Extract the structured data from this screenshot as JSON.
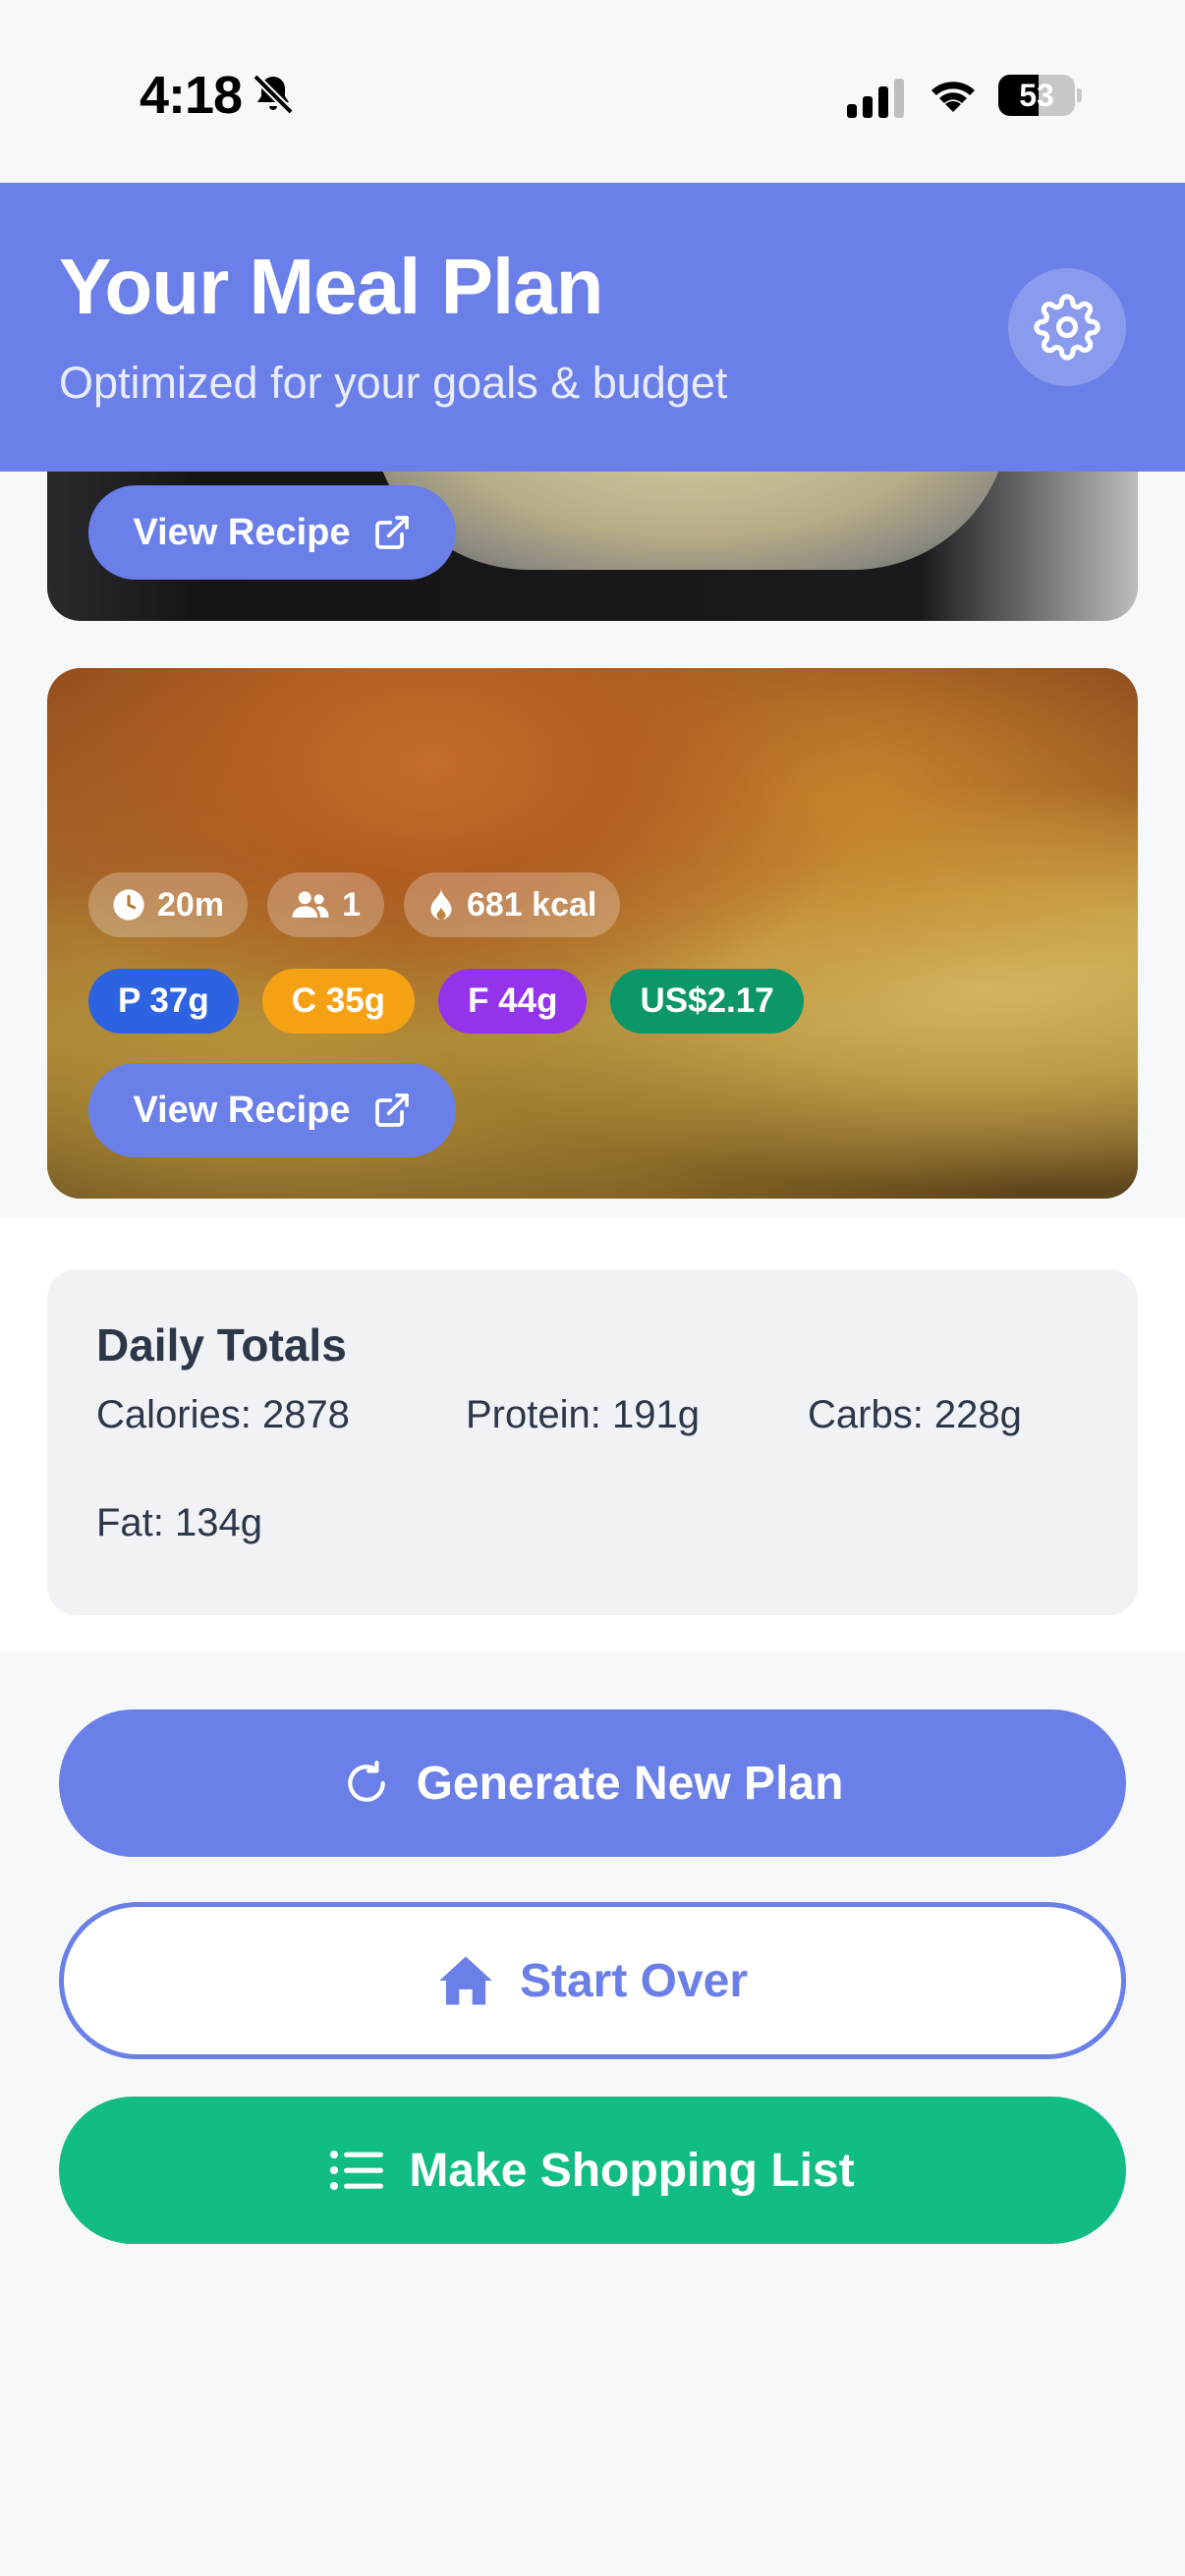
{
  "status_bar": {
    "time": "4:18",
    "battery_level": "53",
    "battery_percent": 53
  },
  "header": {
    "title": "Your Meal Plan",
    "subtitle": "Optimized for your goals & budget",
    "settings_icon": "gear-icon"
  },
  "meals": [
    {
      "view_label": "View Recipe"
    },
    {
      "time": "20m",
      "servings": "1",
      "calories": "681 kcal",
      "protein": "P 37g",
      "carbs": "C 35g",
      "fat": "F 44g",
      "cost": "US$2.17",
      "view_label": "View Recipe"
    }
  ],
  "totals": {
    "title": "Daily Totals",
    "calories": "Calories: 2878",
    "protein": "Protein: 191g",
    "carbs": "Carbs: 228g",
    "fat": "Fat: 134g"
  },
  "actions": {
    "generate": "Generate New Plan",
    "start_over": "Start Over",
    "shopping": "Make Shopping List"
  },
  "colors": {
    "primary": "#6a7fe8",
    "protein": "#2d63e0",
    "carbs": "#f5a114",
    "fat": "#9333ea",
    "cost": "#0d9668",
    "shopping": "#12bc85"
  }
}
